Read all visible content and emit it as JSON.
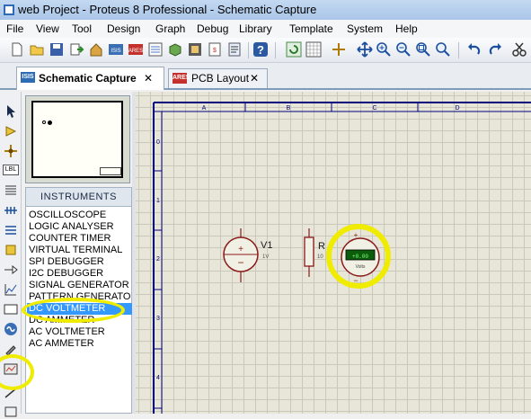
{
  "window": {
    "title": "web Project - Proteus 8 Professional - Schematic Capture"
  },
  "menu": [
    "File",
    "View",
    "Tool",
    "Design",
    "Graph",
    "Debug",
    "Library",
    "Template",
    "System",
    "Help"
  ],
  "tabs": [
    {
      "label": "Schematic Capture",
      "icon": "isis-icon",
      "active": true
    },
    {
      "label": "PCB Layout",
      "icon": "ares-icon",
      "active": false
    }
  ],
  "instruments": {
    "header": "INSTRUMENTS",
    "items": [
      "OSCILLOSCOPE",
      "LOGIC ANALYSER",
      "COUNTER TIMER",
      "VIRTUAL TERMINAL",
      "SPI DEBUGGER",
      "I2C DEBUGGER",
      "SIGNAL GENERATOR",
      "PATTERN GENERATOR",
      "DC VOLTMETER",
      "DC AMMETER",
      "AC VOLTMETER",
      "AC AMMETER"
    ],
    "selected": "DC VOLTMETER"
  },
  "sheet": {
    "columns": [
      "A",
      "B",
      "C",
      "D"
    ],
    "rows": [
      "0",
      "1",
      "2",
      "3",
      "4"
    ]
  },
  "components": {
    "battery_label": "V1",
    "battery_value": "1V",
    "resistor_label": "R",
    "resistor_value": "10",
    "voltmeter_readout": "+0.00",
    "voltmeter_unit": "Volts",
    "voltmeter_plus": "+",
    "voltmeter_minus": "−"
  },
  "colors": {
    "highlight": "#f0ec00",
    "component": "#8b1a1a",
    "selection": "#3399ff"
  }
}
